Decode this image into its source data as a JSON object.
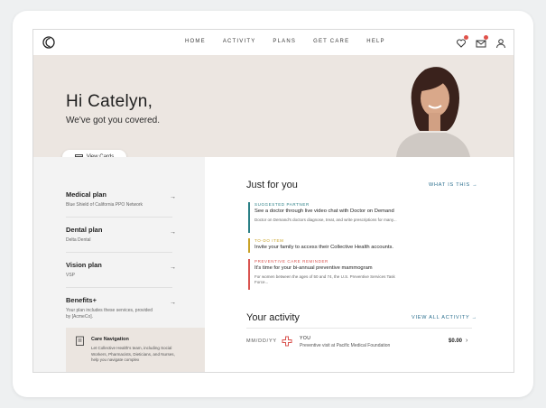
{
  "nav": {
    "links": [
      "HOME",
      "ACTIVITY",
      "PLANS",
      "GET CARE",
      "HELP"
    ]
  },
  "icons": {
    "logo": "logo-icon",
    "notifications": "heart-alert-icon",
    "messages": "envelope-icon",
    "profile": "user-icon"
  },
  "colors": {
    "accent_teal": "#2a6e8e",
    "suggested": "#2a7f85",
    "todo": "#c9a227",
    "reminder": "#d9534f"
  },
  "hero": {
    "greeting": "Hi Catelyn,",
    "subtitle": "We've got you covered."
  },
  "view_cards_label": "View Cards",
  "plans": [
    {
      "title": "Medical plan",
      "subtitle": "Blue Shield of California PPO Network"
    },
    {
      "title": "Dental plan",
      "subtitle": "Delta Dental"
    },
    {
      "title": "Vision plan",
      "subtitle": "VSP"
    },
    {
      "title": "Benefits+",
      "subtitle": "Your plan includes these services, provided by [AcmeCo]."
    }
  ],
  "care_navigation": {
    "title": "Care Navigation",
    "text": "Let Collective Health's team, including Social Workers, Pharmacists, Dieticians, and Nurses, help you navigate complex"
  },
  "just_for_you": {
    "title": "Just for you",
    "link": "WHAT IS THIS →",
    "items": [
      {
        "category": "SUGGESTED PARTNER",
        "headline": "See a doctor through live video chat with Doctor on Demand",
        "description": "Doctor on Demand's doctors diagnose, treat, and write prescriptions for many..."
      },
      {
        "category": "TO-DO ITEM",
        "headline": "Invite your family to access their Collective Health accounts.",
        "description": ""
      },
      {
        "category": "PREVENTIVE CARE REMINDER",
        "headline": "It's time for your bi-annual preventive mammogram",
        "description": "For women between the ages of 50 and 74, the U.S. Preventive Services Task Force..."
      }
    ]
  },
  "activity": {
    "title": "Your activity",
    "link": "VIEW ALL ACTIVITY →",
    "rows": [
      {
        "date": "MM/DD/YY",
        "who": "YOU",
        "description": "Preventive visit at Pacific Medical Foundation",
        "amount": "$0.00"
      }
    ]
  }
}
